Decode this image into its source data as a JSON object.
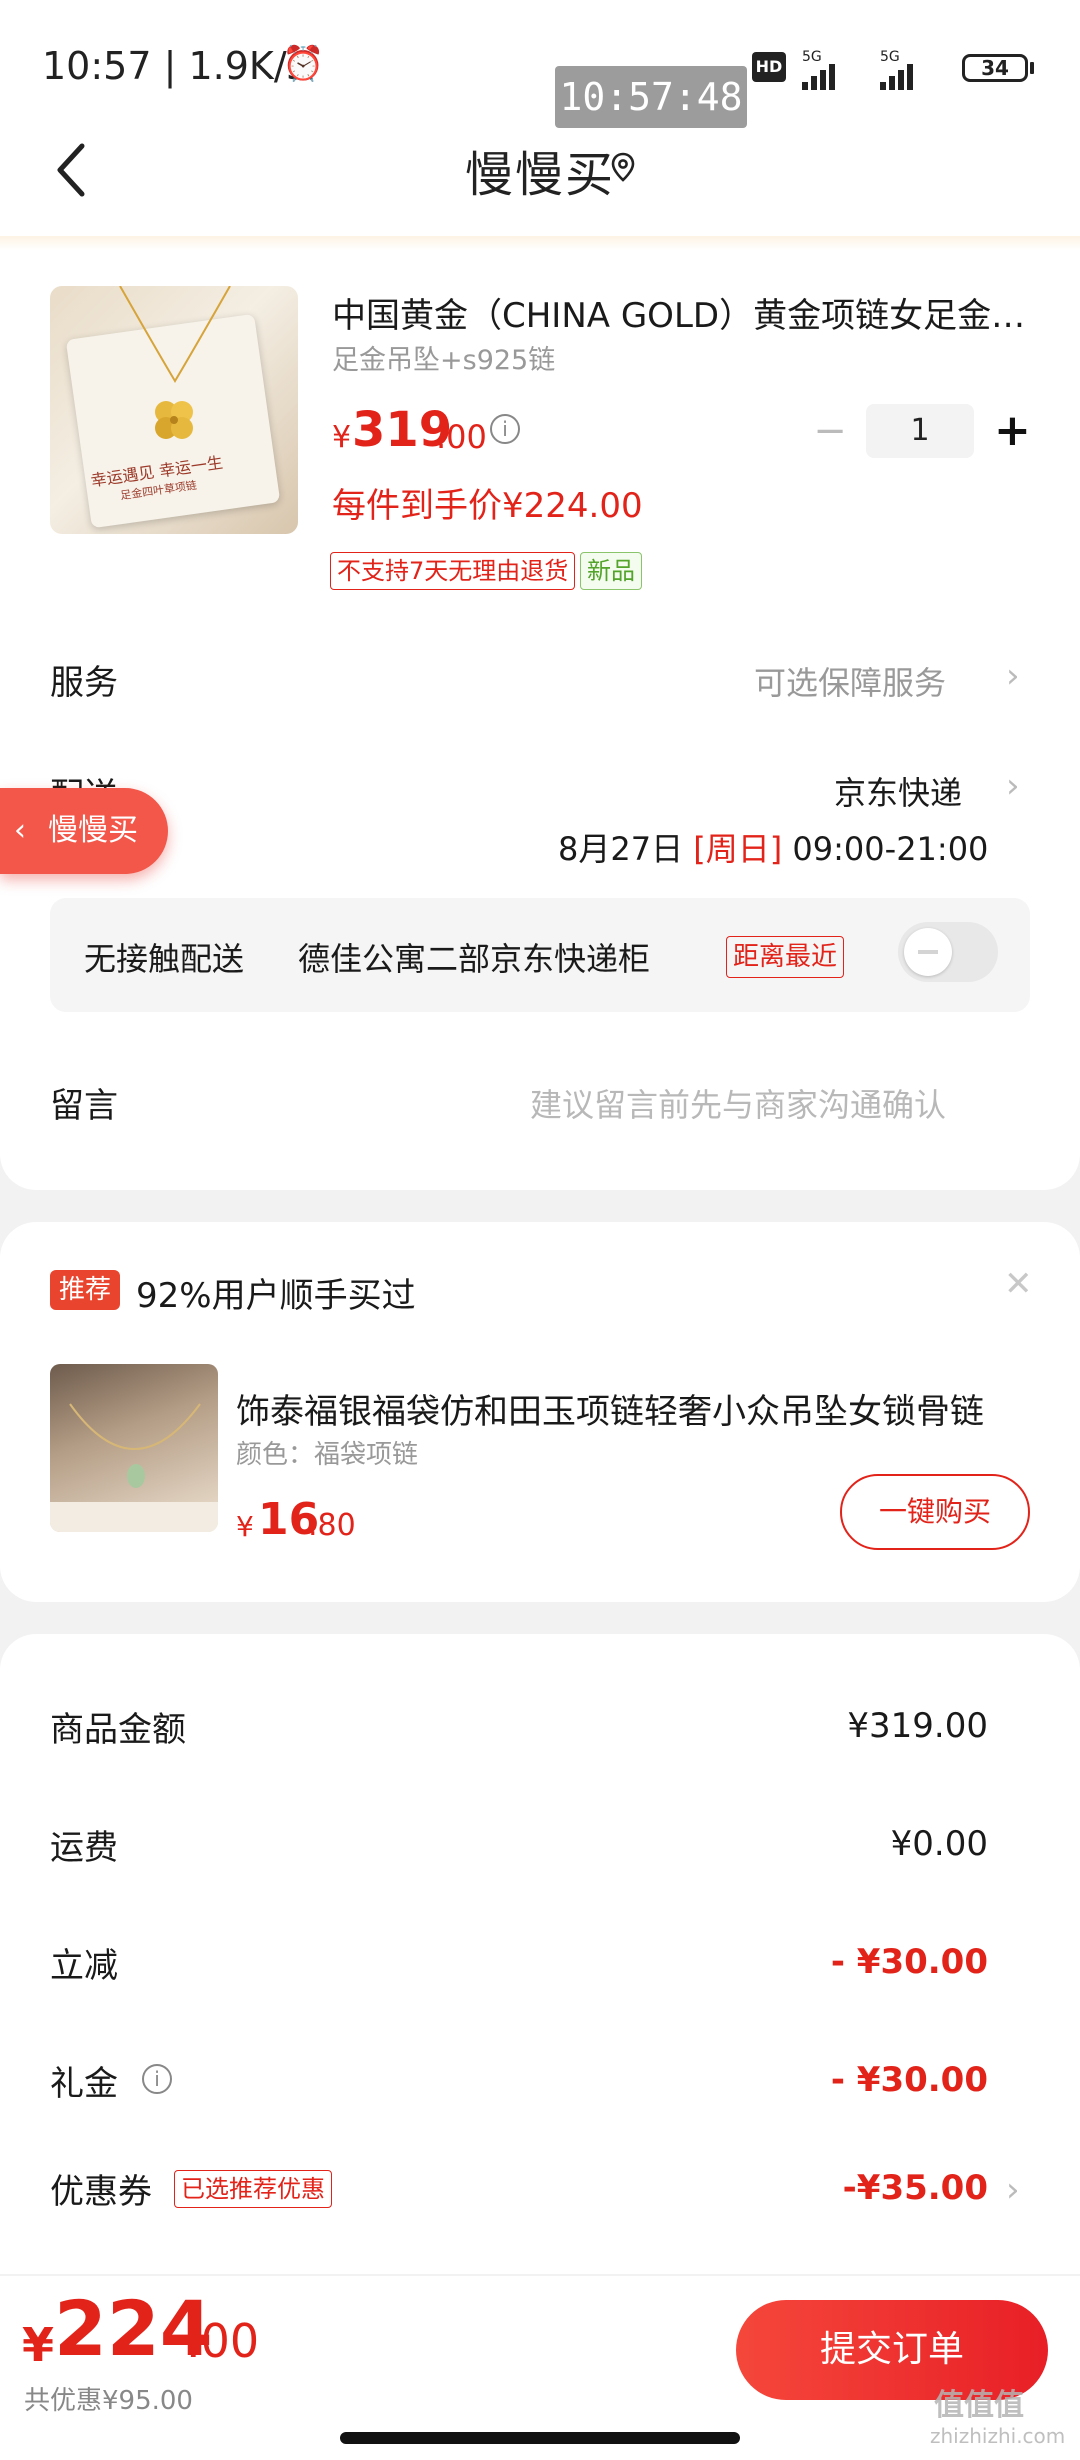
{
  "status_bar": {
    "time": "10:57 | 1.9K/s",
    "clock_overlay": "10:57:48",
    "network_1": "HD",
    "network_2": "5G",
    "network_3": "5G",
    "battery": "34"
  },
  "nav": {
    "title": "慢慢买"
  },
  "product": {
    "title": "中国黄金（CHINA GOLD）黄金项链女足金吊坠",
    "spec": "足金吊坠+s925链",
    "price_symbol": "¥",
    "price_int": "319",
    "price_dec": ".00",
    "quantity": "1",
    "final_price": "每件到手价¥224.00",
    "tags": [
      "不支持7天无理由退货",
      "新品"
    ],
    "image_text_1": "幸运遇见 幸运一生",
    "image_text_2": "足金四叶草项链"
  },
  "service": {
    "label": "服务",
    "value": "可选保障服务"
  },
  "delivery": {
    "label": "配送",
    "carrier": "京东快递",
    "date": "8月27日",
    "weekday": "[周日]",
    "time_window": "09:00-21:00"
  },
  "float_pill": {
    "label": "慢慢买"
  },
  "contactless": {
    "label": "无接触配送",
    "locker": "德佳公寓二部京东快递柜",
    "tag": "距离最近",
    "enabled": false
  },
  "message": {
    "label": "留言",
    "placeholder": "建议留言前先与商家沟通确认"
  },
  "recommend": {
    "badge": "推荐",
    "title": "92%用户顺手买过",
    "item_name": "饰泰福银福袋仿和田玉项链轻奢小众吊坠女锁骨链",
    "item_spec": "颜色：福袋项链",
    "price_symbol": "¥",
    "price_int": "16",
    "price_dec": ".80",
    "buy_label": "一键购买"
  },
  "amounts": {
    "goods_label": "商品金额",
    "goods_value": "¥319.00",
    "shipping_label": "运费",
    "shipping_value": "¥0.00",
    "discount_label": "立减",
    "discount_value": "- ¥30.00",
    "gift_label": "礼金",
    "gift_value": "- ¥30.00",
    "coupon_label": "优惠券",
    "coupon_tag": "已选推荐优惠",
    "coupon_value": "-¥35.00"
  },
  "bottom": {
    "total_symbol": "¥",
    "total_int": "224",
    "total_dec": ".00",
    "saved": "共优惠¥95.00",
    "submit": "提交订单"
  },
  "watermark": {
    "text": "值值值",
    "sub": "zhizhizhi.com"
  },
  "colors": {
    "accent_red": "#e2231a",
    "button_red": "#f5473b",
    "tag_green": "#53a42a"
  }
}
